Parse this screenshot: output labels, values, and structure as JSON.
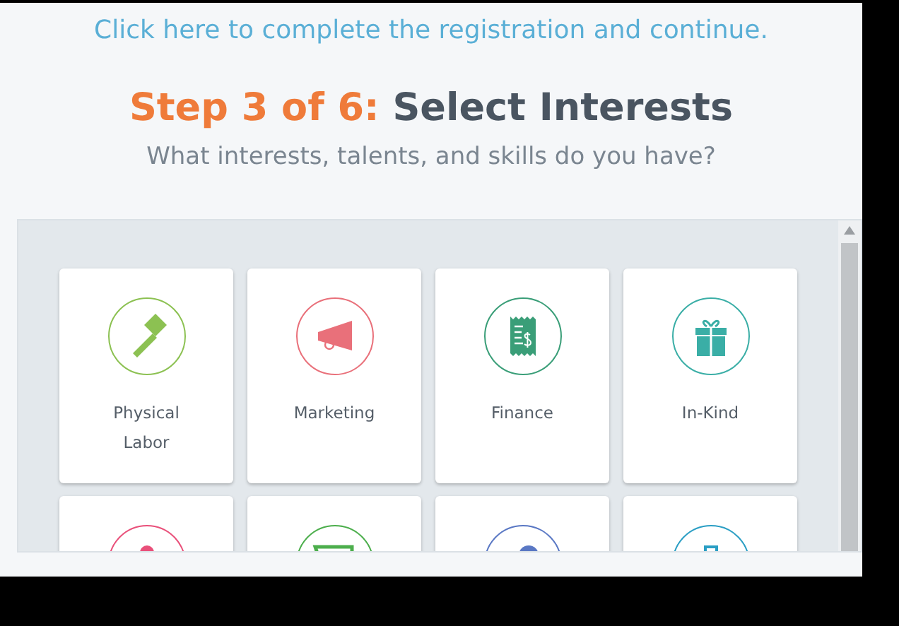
{
  "link": "Click here to complete the registration and continue.",
  "heading": {
    "step": "Step 3 of 6:",
    "title": "Select Interests"
  },
  "subtitle": "What interests, talents, and skills do you have?",
  "interests": [
    {
      "label": "Physical Labor",
      "kind": "hammer",
      "color": "#8cc152"
    },
    {
      "label": "Marketing",
      "kind": "megaphone",
      "color": "#e9707a"
    },
    {
      "label": "Finance",
      "kind": "receipt",
      "color": "#3a9e78"
    },
    {
      "label": "In-Kind",
      "kind": "gift",
      "color": "#3aaea6"
    },
    {
      "kind": "person",
      "color": "#e9507a"
    },
    {
      "kind": "cart",
      "color": "#4cae4c"
    },
    {
      "kind": "chat",
      "color": "#5a78c4"
    },
    {
      "kind": "briefcase",
      "color": "#2a9ec4"
    }
  ]
}
